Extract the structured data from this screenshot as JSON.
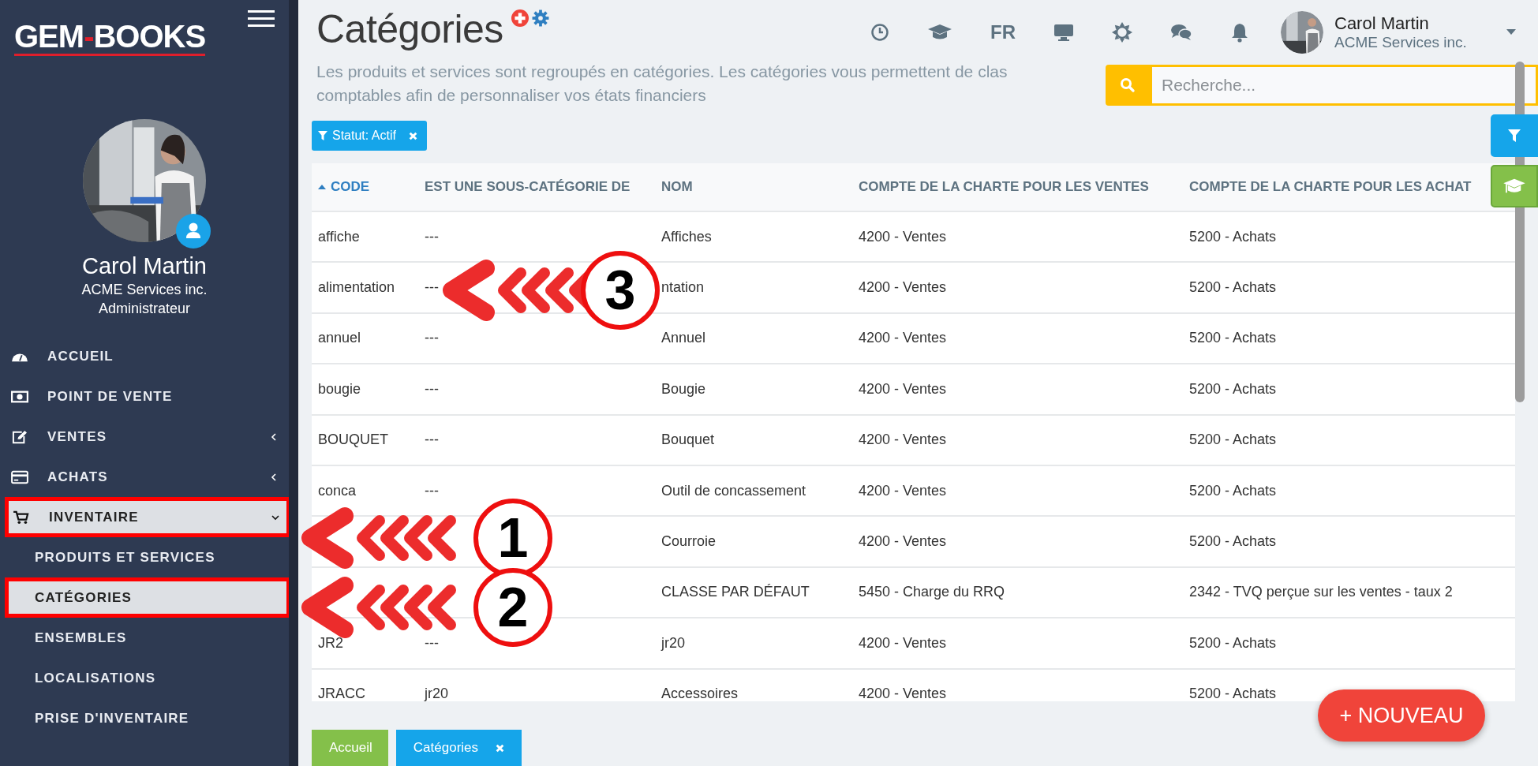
{
  "sidebar": {
    "logo": {
      "left": "GEM",
      "separator": "-",
      "right": "BOOKS"
    },
    "profile": {
      "name": "Carol Martin",
      "company": "ACME Services inc.",
      "role": "Administrateur"
    },
    "menu": [
      {
        "label": "ACCUEIL",
        "kind": "link",
        "selected": false,
        "highlighted": false
      },
      {
        "label": "POINT DE VENTE",
        "kind": "link",
        "selected": false,
        "highlighted": false
      },
      {
        "label": "VENTES",
        "kind": "submenu",
        "expanded": false,
        "selected": false,
        "highlighted": false
      },
      {
        "label": "ACHATS",
        "kind": "submenu",
        "expanded": false,
        "selected": false,
        "highlighted": false
      },
      {
        "label": "INVENTAIRE",
        "kind": "submenu",
        "expanded": true,
        "selected": true,
        "highlighted": true,
        "children": [
          {
            "label": "PRODUITS ET SERVICES",
            "selected": false,
            "highlighted": false
          },
          {
            "label": "CATÉGORIES",
            "selected": true,
            "highlighted": true
          },
          {
            "label": "ENSEMBLES",
            "selected": false,
            "highlighted": false
          },
          {
            "label": "LOCALISATIONS",
            "selected": false,
            "highlighted": false
          },
          {
            "label": "PRISE D'INVENTAIRE",
            "selected": false,
            "highlighted": false
          }
        ]
      }
    ]
  },
  "header": {
    "title": "Catégories",
    "language": "FR",
    "user": {
      "name": "Carol Martin",
      "company": "ACME Services inc."
    }
  },
  "description": [
    "Les produits et services sont regroupés en catégories. Les catégories vous permettent de clas",
    "comptables afin de personnaliser vos états financiers"
  ],
  "search": {
    "placeholder": "Recherche..."
  },
  "filters": [
    {
      "label": "Statut: Actif"
    }
  ],
  "table": {
    "columns": [
      {
        "label": "CODE",
        "sorted": true
      },
      {
        "label": "EST UNE SOUS-CATÉGORIE DE",
        "sorted": false
      },
      {
        "label": "NOM",
        "sorted": false
      },
      {
        "label": "COMPTE DE LA CHARTE POUR LES VENTES",
        "sorted": false
      },
      {
        "label": "COMPTE DE LA CHARTE POUR LES ACHAT",
        "sorted": false
      }
    ],
    "rows": [
      [
        "affiche",
        "---",
        "Affiches",
        "4200 - Ventes",
        "5200 - Achats"
      ],
      [
        "alimentation",
        "---",
        "ntation",
        "4200 - Ventes",
        "5200 - Achats"
      ],
      [
        "annuel",
        "---",
        "Annuel",
        "4200 - Ventes",
        "5200 - Achats"
      ],
      [
        "bougie",
        "---",
        "Bougie",
        "4200 - Ventes",
        "5200 - Achats"
      ],
      [
        "BOUQUET",
        "---",
        "Bouquet",
        "4200 - Ventes",
        "5200 - Achats"
      ],
      [
        "conca",
        "---",
        "Outil de concassement",
        "4200 - Ventes",
        "5200 - Achats"
      ],
      [
        "",
        "",
        "Courroie",
        "4200 - Ventes",
        "5200 - Achats"
      ],
      [
        "",
        "",
        "CLASSE PAR DÉFAUT",
        "5450 - Charge du RRQ",
        "2342 - TVQ perçue sur les ventes - taux 2"
      ],
      [
        "JR2",
        "---",
        "jr20",
        "4200 - Ventes",
        "5200 - Achats"
      ],
      [
        "JRACC",
        "jr20",
        "Accessoires",
        "4200 - Ventes",
        "5200 - Achats"
      ]
    ]
  },
  "new_button": {
    "label": "+ NOUVEAU"
  },
  "bottom_tabs": [
    {
      "label": "Accueil",
      "selected": false,
      "closable": false
    },
    {
      "label": "Catégories",
      "selected": true,
      "closable": true
    }
  ],
  "callouts": [
    {
      "number": "1"
    },
    {
      "number": "2"
    },
    {
      "number": "3"
    }
  ]
}
